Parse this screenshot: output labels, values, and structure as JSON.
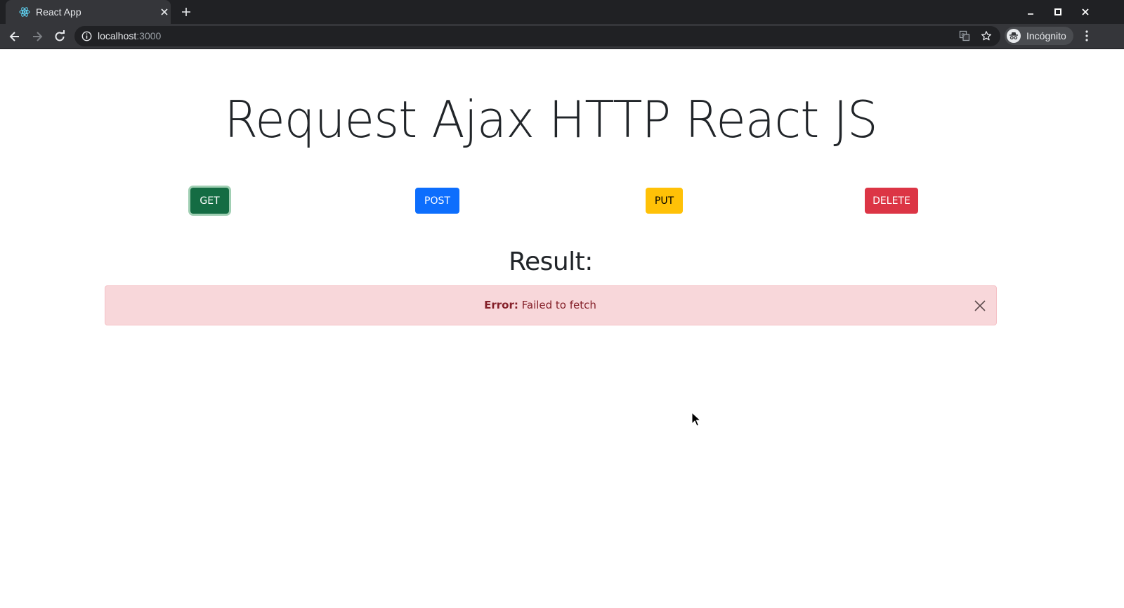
{
  "browser": {
    "tab_title": "React App",
    "url_host": "localhost",
    "url_port": ":3000",
    "profile_label": "Incógnito",
    "icons": [
      "react-favicon-icon",
      "close-icon",
      "plus-icon",
      "minimize-icon",
      "maximize-icon",
      "close-window-icon",
      "back-arrow-icon",
      "forward-arrow-icon",
      "reload-icon",
      "info-icon",
      "translate-icon",
      "star-icon",
      "incognito-icon",
      "kebab-menu-icon"
    ]
  },
  "page": {
    "title": "Request Ajax HTTP React JS",
    "buttons": {
      "get": "GET",
      "post": "POST",
      "put": "PUT",
      "delete": "DELETE"
    },
    "result_heading": "Result:",
    "alert": {
      "label": "Error:",
      "message": "Failed to fetch"
    }
  },
  "colors": {
    "get": "#146c43",
    "post": "#0d6efd",
    "put": "#ffc107",
    "delete": "#dc3545",
    "alert_bg": "#f8d7da",
    "alert_text": "#842029"
  }
}
